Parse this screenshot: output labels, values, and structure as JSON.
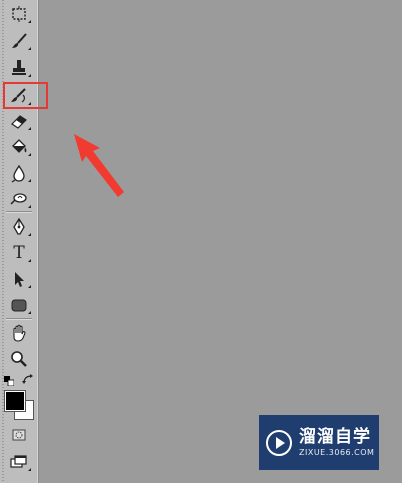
{
  "toolbar": {
    "tools": [
      {
        "name": "marquee-tool",
        "icon": "marquee-icon"
      },
      {
        "name": "brush-tool",
        "icon": "brush-icon"
      },
      {
        "name": "clone-stamp-tool",
        "icon": "stamp-icon"
      },
      {
        "name": "history-brush-tool",
        "icon": "history-brush-icon"
      },
      {
        "name": "eraser-tool",
        "icon": "eraser-icon"
      },
      {
        "name": "paint-bucket-tool",
        "icon": "bucket-icon"
      },
      {
        "name": "blur-tool",
        "icon": "drop-icon"
      },
      {
        "name": "dodge-tool",
        "icon": "dodge-icon"
      },
      {
        "name": "pen-tool",
        "icon": "pen-icon"
      },
      {
        "name": "type-tool",
        "icon": "type-icon",
        "label": "T"
      },
      {
        "name": "path-selection-tool",
        "icon": "arrow-icon"
      },
      {
        "name": "rectangle-tool",
        "icon": "rounded-rect-icon"
      },
      {
        "name": "hand-tool",
        "icon": "hand-icon"
      },
      {
        "name": "zoom-tool",
        "icon": "magnifier-icon"
      }
    ],
    "colors": {
      "foreground": "#000000",
      "background": "#ffffff"
    },
    "highlighted_tool": "history-brush-tool"
  },
  "canvas": {
    "background": "#9b9b9b"
  },
  "annotation": {
    "highlight_color": "#e53935"
  },
  "watermark": {
    "name": "溜溜自学",
    "url": "ZIXUE.3066.COM"
  }
}
